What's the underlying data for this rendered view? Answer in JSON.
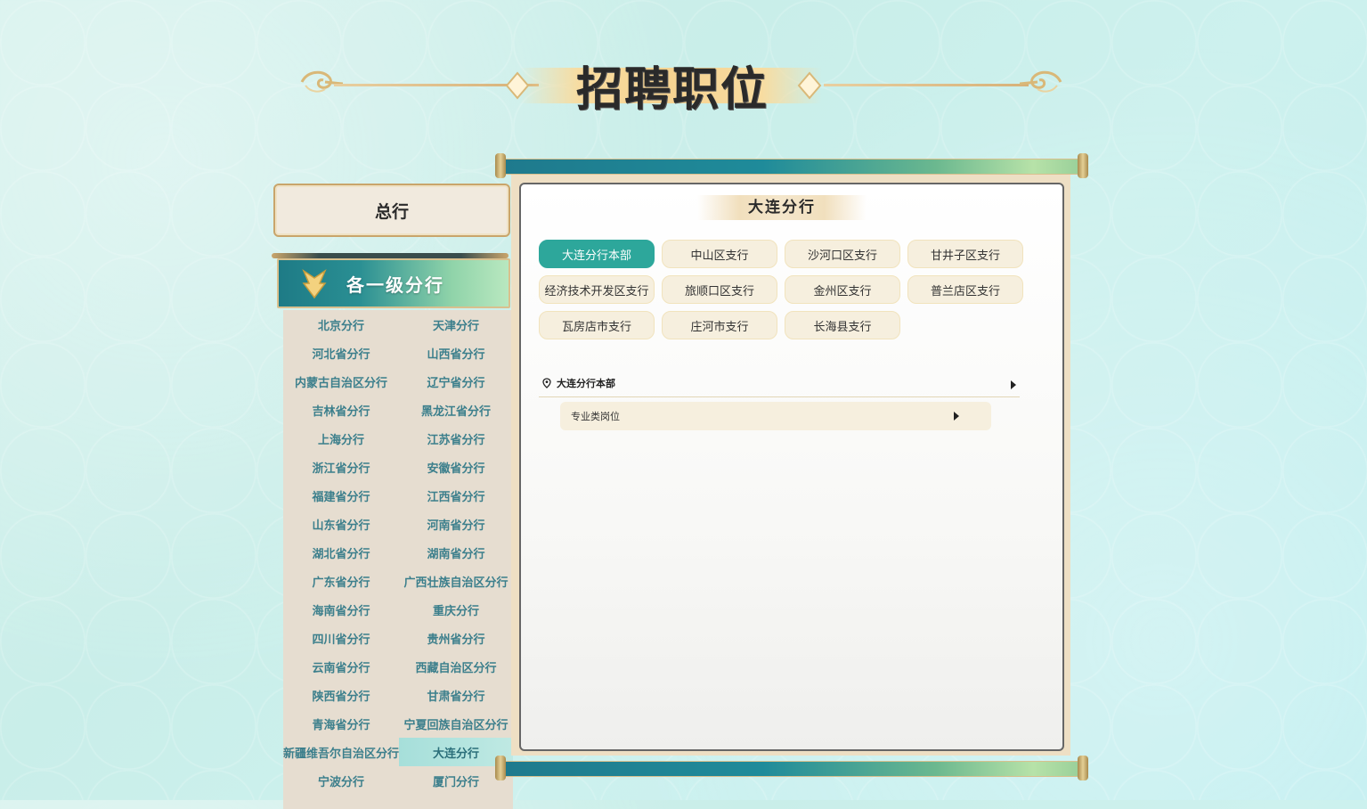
{
  "page": {
    "title": "招聘职位"
  },
  "headquarters": {
    "label": "总行"
  },
  "branches": {
    "header": "各一级分行",
    "items": [
      {
        "label": "北京分行",
        "active": false
      },
      {
        "label": "天津分行",
        "active": false
      },
      {
        "label": "河北省分行",
        "active": false
      },
      {
        "label": "山西省分行",
        "active": false
      },
      {
        "label": "内蒙古自治区分行",
        "active": false
      },
      {
        "label": "辽宁省分行",
        "active": false
      },
      {
        "label": "吉林省分行",
        "active": false
      },
      {
        "label": "黑龙江省分行",
        "active": false
      },
      {
        "label": "上海分行",
        "active": false
      },
      {
        "label": "江苏省分行",
        "active": false
      },
      {
        "label": "浙江省分行",
        "active": false
      },
      {
        "label": "安徽省分行",
        "active": false
      },
      {
        "label": "福建省分行",
        "active": false
      },
      {
        "label": "江西省分行",
        "active": false
      },
      {
        "label": "山东省分行",
        "active": false
      },
      {
        "label": "河南省分行",
        "active": false
      },
      {
        "label": "湖北省分行",
        "active": false
      },
      {
        "label": "湖南省分行",
        "active": false
      },
      {
        "label": "广东省分行",
        "active": false
      },
      {
        "label": "广西壮族自治区分行",
        "active": false
      },
      {
        "label": "海南省分行",
        "active": false
      },
      {
        "label": "重庆分行",
        "active": false
      },
      {
        "label": "四川省分行",
        "active": false
      },
      {
        "label": "贵州省分行",
        "active": false
      },
      {
        "label": "云南省分行",
        "active": false
      },
      {
        "label": "西藏自治区分行",
        "active": false
      },
      {
        "label": "陕西省分行",
        "active": false
      },
      {
        "label": "甘肃省分行",
        "active": false
      },
      {
        "label": "青海省分行",
        "active": false
      },
      {
        "label": "宁夏回族自治区分行",
        "active": false
      },
      {
        "label": "新疆维吾尔自治区分行",
        "active": false
      },
      {
        "label": "大连分行",
        "active": true
      },
      {
        "label": "宁波分行",
        "active": false
      },
      {
        "label": "厦门分行",
        "active": false
      }
    ]
  },
  "panel": {
    "title": "大连分行",
    "sub_branches": [
      {
        "label": "大连分行本部",
        "active": true
      },
      {
        "label": "中山区支行",
        "active": false
      },
      {
        "label": "沙河口区支行",
        "active": false
      },
      {
        "label": "甘井子区支行",
        "active": false
      },
      {
        "label": "经济技术开发区支行",
        "active": false
      },
      {
        "label": "旅顺口区支行",
        "active": false
      },
      {
        "label": "金州区支行",
        "active": false
      },
      {
        "label": "普兰店区支行",
        "active": false
      },
      {
        "label": "瓦房店市支行",
        "active": false
      },
      {
        "label": "庄河市支行",
        "active": false
      },
      {
        "label": "长海县支行",
        "active": false
      }
    ],
    "location": "大连分行本部",
    "category": "专业类岗位"
  },
  "colors": {
    "accent_teal": "#2da79b",
    "branch_text": "#3c7f8c",
    "gold": "#d9c08e"
  }
}
